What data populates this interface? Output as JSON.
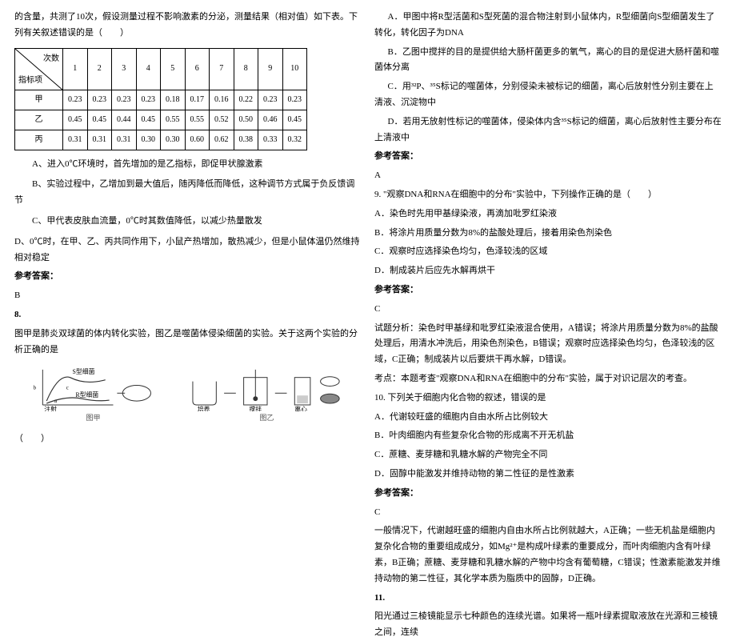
{
  "left": {
    "intro": "的含量，共测了10次，假设测量过程不影响激素的分泌，测量结果（相对值）如下表。下列有关叙述错误的是（　　）",
    "table": {
      "row_header_top": "次数",
      "row_header_bot": "指标项",
      "cols": [
        "1",
        "2",
        "3",
        "4",
        "5",
        "6",
        "7",
        "8",
        "9",
        "10"
      ],
      "rows": [
        {
          "name": "甲",
          "vals": [
            "0.23",
            "0.23",
            "0.23",
            "0.23",
            "0.18",
            "0.17",
            "0.16",
            "0.22",
            "0.23",
            "0.23"
          ]
        },
        {
          "name": "乙",
          "vals": [
            "0.45",
            "0.45",
            "0.44",
            "0.45",
            "0.55",
            "0.55",
            "0.52",
            "0.50",
            "0.46",
            "0.45"
          ]
        },
        {
          "name": "丙",
          "vals": [
            "0.31",
            "0.31",
            "0.31",
            "0.30",
            "0.30",
            "0.60",
            "0.62",
            "0.38",
            "0.33",
            "0.32"
          ]
        }
      ]
    },
    "optA": "A、进入0℃环境时，首先增加的是乙指标，即促甲状腺激素",
    "optB": "B、实验过程中，乙增加到最大值后，随丙降低而降低，这种调节方式属于负反馈调节",
    "optC": "C、甲代表皮肤血流量，0℃时其数值降低，以减少热量散发",
    "optD": "D、0℃时，在甲、乙、丙共同作用下，小鼠产热增加，散热减少，但是小鼠体温仍然维持相对稳定",
    "ans_title": "参考答案：",
    "ans_val": "B",
    "q8_num": "8.",
    "q8_text": "图甲是肺炎双球菌的体内转化实验，图乙是噬菌体侵染细菌的实验。关于这两个实验的分析正确的是",
    "fig_left_label": "图甲",
    "fig_right_label": "图乙",
    "fig_text_s": "S型细菌",
    "fig_text_r": "R型细菌",
    "fig_text_stir": "搅拌",
    "fig_text_cent": "离心",
    "fig_text_cult": "培养",
    "fig_inject": "注射",
    "paren": "（　　）"
  },
  "right": {
    "r_optA": "A．甲图中将R型活菌和S型死菌的混合物注射到小鼠体内，R型细菌向S型细菌发生了转化，转化因子为DNA",
    "r_optB": "B．乙图中搅拌的目的是提供给大肠杆菌更多的氧气，离心的目的是促进大肠杆菌和噬菌体分离",
    "r_optC": "C．用³²P、³⁵S标记的噬菌体，分别侵染未被标记的细菌，离心后放射性分别主要在上清液、沉淀物中",
    "r_optD": "D．若用无放射性标记的噬菌体，侵染体内含³⁵S标记的细菌，离心后放射性主要分布在上清液中",
    "r_ans_title": "参考答案：",
    "r_ans_val": "A",
    "q9_text": "9. \"观察DNA和RNA在细胞中的分布\"实验中，下列操作正确的是（　　）",
    "q9_A": "A．染色时先用甲基绿染液，再滴加吡罗红染液",
    "q9_B": "B．将涂片用质量分数为8%的盐酸处理后，接着用染色剂染色",
    "q9_C": "C．观察时应选择染色均匀，色泽较浅的区域",
    "q9_D": "D．制成装片后应先水解再烘干",
    "q9_ans_title": "参考答案：",
    "q9_ans_val": "C",
    "q9_analysis": "试题分析：染色时甲基绿和吡罗红染液混合使用，A错误；将涂片用质量分数为8%的盐酸处理后，用清水冲洗后，用染色剂染色，B错误；观察时应选择染色均匀，色泽较浅的区域，C正确；制成装片以后要烘干再水解，D错误。",
    "q9_point": "考点：本题考查\"观察DNA和RNA在细胞中的分布\"实验，属于对识记层次的考查。",
    "q10_text": "10. 下列关于细胞内化合物的叙述，错误的是",
    "q10_A": "A．代谢较旺盛的细胞内自由水所占比例较大",
    "q10_B": "B．叶肉细胞内有些复杂化合物的形成离不开无机盐",
    "q10_C": "C．蔗糖、麦芽糖和乳糖水解的产物完全不同",
    "q10_D": "D．固醇中能激发并维持动物的第二性征的是性激素",
    "q10_ans_title": "参考答案：",
    "q10_ans_val": "C",
    "q10_analysis": "一般情况下，代谢越旺盛的细胞内自由水所占比例就越大，A正确；一些无机盐是细胞内复杂化合物的重要组成成分，如Mg²⁺是构成叶绿素的重要成分，而叶肉细胞内含有叶绿素，B正确；蔗糖、麦芽糖和乳糖水解的产物中均含有葡萄糖，C错误；性激素能激发并维持动物的第二性征，其化学本质为脂质中的固醇，D正确。",
    "q11_num": "11.",
    "q11_text": "阳光通过三棱镜能显示七种颜色的连续光谱。如果将一瓶叶绿素提取液放在光源和三棱镜之间，连续"
  }
}
